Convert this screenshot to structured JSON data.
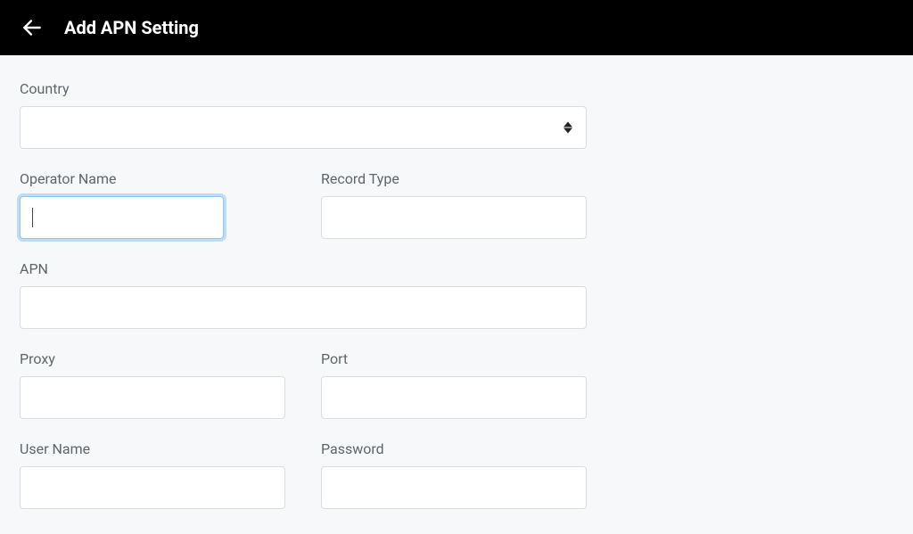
{
  "header": {
    "title": "Add APN Setting"
  },
  "form": {
    "country": {
      "label": "Country",
      "value": ""
    },
    "operatorName": {
      "label": "Operator Name",
      "value": ""
    },
    "recordType": {
      "label": "Record Type",
      "value": ""
    },
    "apn": {
      "label": "APN",
      "value": ""
    },
    "proxy": {
      "label": "Proxy",
      "value": ""
    },
    "port": {
      "label": "Port",
      "value": ""
    },
    "userName": {
      "label": "User Name",
      "value": ""
    },
    "password": {
      "label": "Password",
      "value": ""
    }
  }
}
